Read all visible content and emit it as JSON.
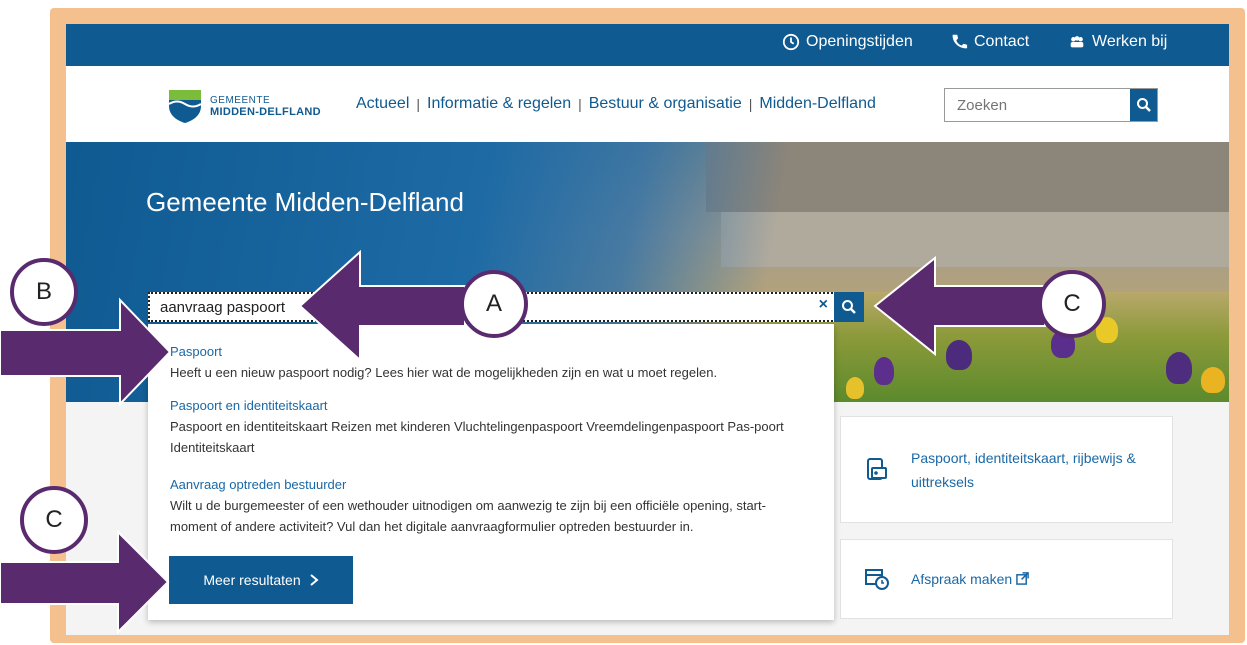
{
  "topbar": {
    "links": [
      {
        "label": "Openingstijden",
        "icon": "clock-icon"
      },
      {
        "label": "Contact",
        "icon": "phone-icon"
      },
      {
        "label": "Werken bij",
        "icon": "people-icon"
      }
    ]
  },
  "header": {
    "logo": {
      "line1": "GEMEENTE",
      "line2": "MIDDEN-DELFLAND"
    },
    "nav": [
      "Actueel",
      "Informatie & regelen",
      "Bestuur & organisatie",
      "Midden-Delfland"
    ],
    "search_placeholder": "Zoeken"
  },
  "hero": {
    "title": "Gemeente Midden-Delfland",
    "search_value": "aanvraag paspoort",
    "clear_symbol": "×"
  },
  "dropdown": {
    "results": [
      {
        "title": "Paspoort",
        "text": "Heeft u een nieuw paspoort nodig? Lees hier wat de mogelijkheden zijn en wat u moet regelen."
      },
      {
        "title": "Paspoort en identiteitskaart",
        "text": "Paspoort en identiteitskaart Reizen met kinderen Vluchtelingenpaspoort Vreemdelingenpaspoort Pas-poort Identiteitskaart"
      },
      {
        "title": "Aanvraag optreden bestuurder",
        "text": "Wilt u de burgemeester of een wethouder uitnodigen om aanwezig te zijn bij een officiële opening, start-moment of andere activiteit? Vul dan het digitale aanvraagformulier optreden bestuurder  in."
      }
    ],
    "more_label": "Meer resultaten"
  },
  "cards": [
    {
      "label": "Paspoort, identiteitskaart, rijbewijs & uittreksels",
      "icon": "id-card-icon"
    },
    {
      "label": "Afspraak maken",
      "icon": "calendar-clock-icon"
    }
  ],
  "annotations": {
    "a": "A",
    "b": "B",
    "c1": "C",
    "c2": "C"
  },
  "colors": {
    "brand": "#0f5a91",
    "link": "#1a68a6",
    "arrow": "#5a2a6e",
    "frame": "#f3c08e"
  }
}
